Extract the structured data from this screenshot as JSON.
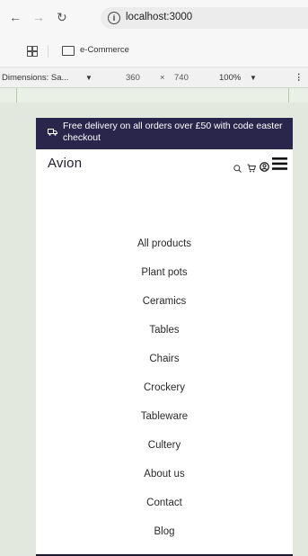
{
  "browser": {
    "back_icon": "arrow-left-icon",
    "forward_icon": "arrow-right-icon",
    "reload_icon": "reload-icon",
    "url": "localhost:3000",
    "bookmark_folder": "e-Commerce"
  },
  "devtools": {
    "dimensions": "Dimensions: Sa...",
    "width": "360",
    "times": "×",
    "height": "740",
    "zoom": "100%",
    "more": "⋮"
  },
  "site": {
    "promo_text": "Free delivery on all orders over £50 with code easter",
    "promo_text_2": "checkout",
    "logo": "Avion",
    "icons": [
      "search-icon",
      "cart-icon",
      "user-icon",
      "menu-icon"
    ],
    "menu": [
      "All products",
      "Plant pots",
      "Ceramics",
      "Tables",
      "Chairs",
      "Crockery",
      "Tableware",
      "Cultery",
      "About us",
      "Contact",
      "Blog"
    ],
    "brand_color": "#2a254b"
  }
}
